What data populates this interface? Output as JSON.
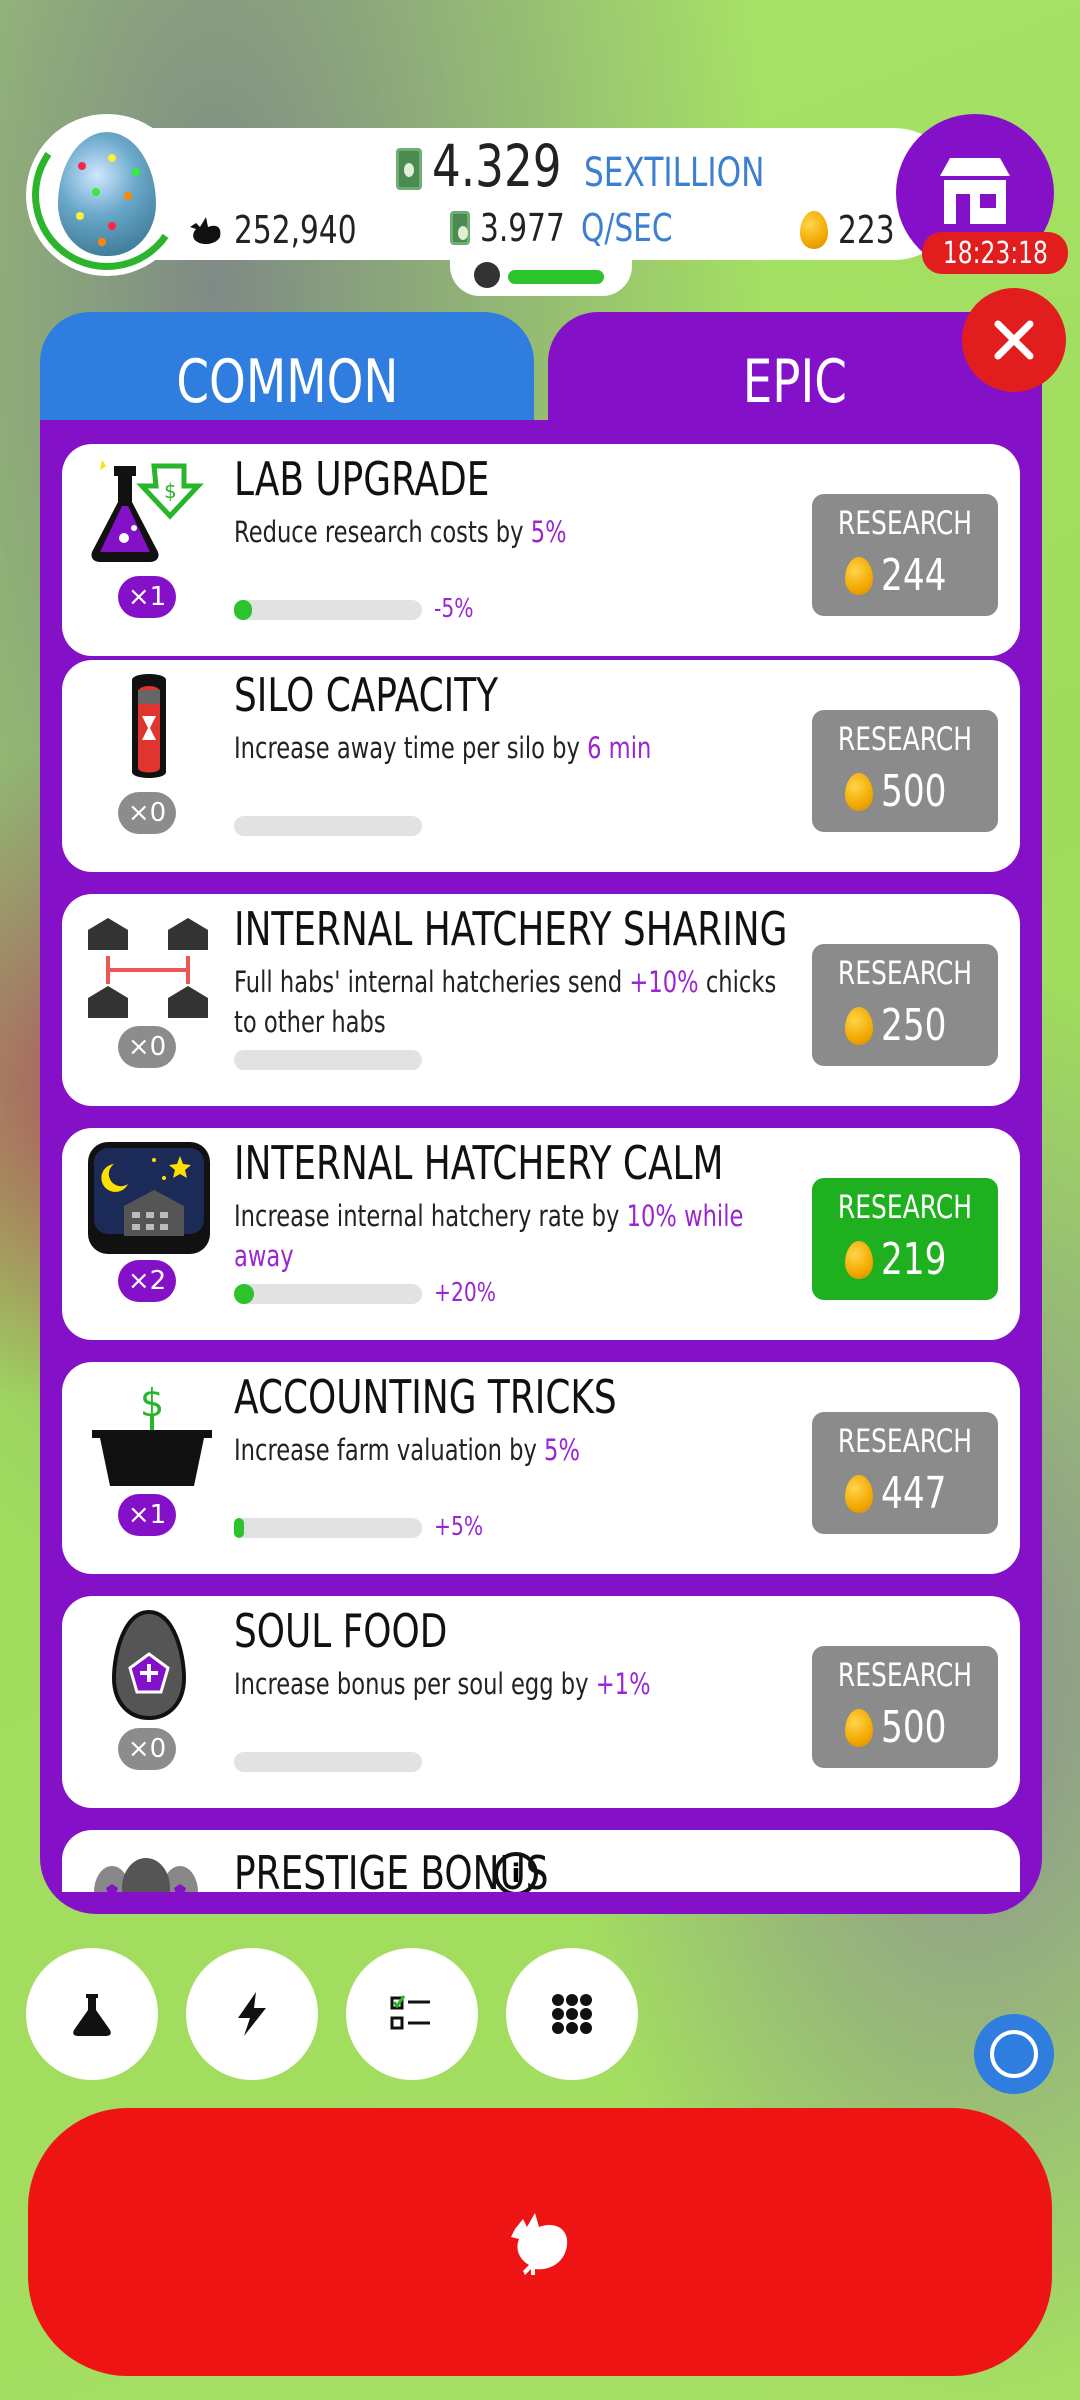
{
  "header": {
    "cash_value": "4.329",
    "cash_unit": "SEXTILLION",
    "chickens": "252,940",
    "rate_value": "3.977",
    "rate_unit": "Q/SEC",
    "golden_eggs": "223",
    "shop_timer": "18:23:18",
    "hab_progress": 0.9
  },
  "tabs": [
    {
      "label": "COMMON",
      "selected": false
    },
    {
      "label": "EPIC",
      "selected": true
    }
  ],
  "research": [
    {
      "title": "LAB UPGRADE",
      "desc_pre": "Reduce research costs by ",
      "desc_hl": "5%",
      "desc_post": "",
      "level": "×1",
      "progress": 0.05,
      "progress_note": "-5%",
      "button_label": "RESEARCH",
      "price": "244",
      "enabled": false,
      "icon": "flask-icon"
    },
    {
      "title": "SILO CAPACITY",
      "desc_pre": "Increase away time per silo by ",
      "desc_hl": "6 min",
      "desc_post": "",
      "level": "×0",
      "progress": 0,
      "progress_note": "",
      "button_label": "RESEARCH",
      "price": "500",
      "enabled": false,
      "icon": "silo-icon"
    },
    {
      "title": "INTERNAL HATCHERY SHARING",
      "desc_pre": "Full habs' internal hatcheries send ",
      "desc_hl": "+10%",
      "desc_post": " chicks to other habs",
      "level": "×0",
      "progress": 0,
      "progress_note": "",
      "button_label": "RESEARCH",
      "price": "250",
      "enabled": false,
      "icon": "hatchery-sharing-icon"
    },
    {
      "title": "INTERNAL HATCHERY CALM",
      "desc_pre": "Increase internal hatchery rate by ",
      "desc_hl": "10% while away",
      "desc_post": "",
      "level": "×2",
      "progress": 0.1,
      "progress_note": "+20%",
      "button_label": "RESEARCH",
      "price": "219",
      "enabled": true,
      "icon": "night-hatchery-icon"
    },
    {
      "title": "ACCOUNTING TRICKS",
      "desc_pre": "Increase farm valuation by ",
      "desc_hl": "5%",
      "desc_post": "",
      "level": "×1",
      "progress": 0.04,
      "progress_note": "+5%",
      "button_label": "RESEARCH",
      "price": "447",
      "enabled": false,
      "icon": "top-hat-icon"
    },
    {
      "title": "SOUL FOOD",
      "desc_pre": "Increase bonus per soul egg by ",
      "desc_hl": "+1%",
      "desc_post": "",
      "level": "×0",
      "progress": 0,
      "progress_note": "",
      "button_label": "RESEARCH",
      "price": "500",
      "enabled": false,
      "icon": "soul-egg-icon"
    }
  ],
  "partial_card": {
    "title": "PRESTIGE BONUS",
    "info": "i"
  },
  "bottom_nav": [
    "research-flask-icon",
    "boost-lightning-icon",
    "checklist-icon",
    "grid-menu-icon"
  ],
  "colors": {
    "purple": "#8411c8",
    "blue": "#2f7ddf",
    "red": "#e21d1d",
    "green": "#1fb01f",
    "highlight": "#9a26d2"
  }
}
